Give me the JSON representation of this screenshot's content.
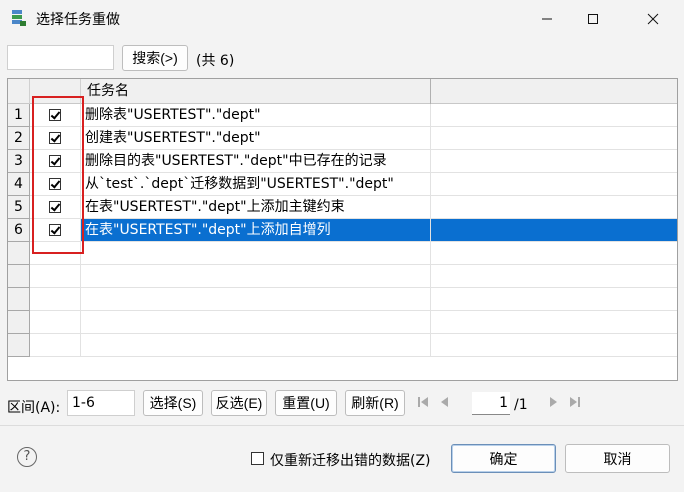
{
  "window": {
    "title": "选择任务重做",
    "minimize_glyph": "─",
    "maximize_glyph": "□",
    "close_glyph": "✕"
  },
  "search": {
    "value": "",
    "button_label": "搜索(>)",
    "count_text": "(共 6)"
  },
  "table": {
    "columns": [
      "",
      "",
      "任务名"
    ],
    "rows": [
      {
        "num": "1",
        "checked": true,
        "name": "删除表\"USERTEST\".\"dept\""
      },
      {
        "num": "2",
        "checked": true,
        "name": "创建表\"USERTEST\".\"dept\""
      },
      {
        "num": "3",
        "checked": true,
        "name": "删除目的表\"USERTEST\".\"dept\"中已存在的记录"
      },
      {
        "num": "4",
        "checked": true,
        "name": "从`test`.`dept`迁移数据到\"USERTEST\".\"dept\""
      },
      {
        "num": "5",
        "checked": true,
        "name": "在表\"USERTEST\".\"dept\"上添加主键约束"
      },
      {
        "num": "6",
        "checked": true,
        "name": "在表\"USERTEST\".\"dept\"上添加自增列",
        "selected": true
      }
    ],
    "empty_rows": 5,
    "selection_color": "#0a6fd0",
    "highlight_color": "#d82020"
  },
  "bottom": {
    "range_label": "区间(A):",
    "range_value": "1-6",
    "select_label": "选择(S)",
    "invert_label": "反选(E)",
    "reset_label": "重置(U)",
    "refresh_label": "刷新(R)",
    "page_value": "1",
    "page_total": "/1"
  },
  "footer": {
    "help_glyph": "?",
    "retry_errors_label": "仅重新迁移出错的数据(Z)",
    "ok_label": "确定",
    "cancel_label": "取消"
  }
}
